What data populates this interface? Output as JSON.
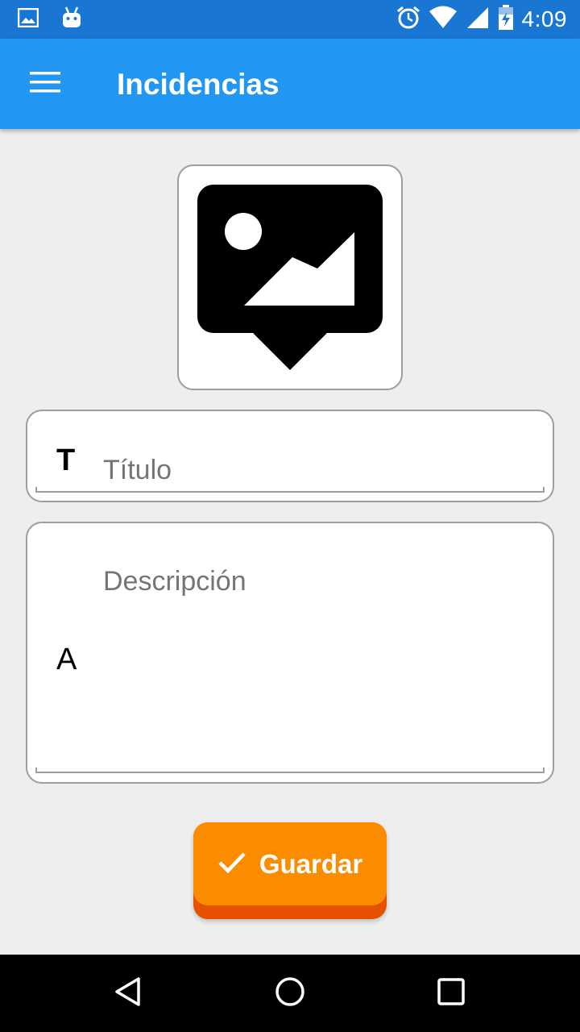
{
  "status_bar": {
    "time": "4:09",
    "left_icons": [
      "image-notification-icon",
      "android-notification-icon"
    ],
    "right_icons": [
      "alarm-icon",
      "wifi-icon",
      "signal-icon",
      "battery-charging-icon"
    ]
  },
  "app_bar": {
    "title": "Incidencias",
    "menu_icon": "hamburger-menu-icon",
    "color": "#2196f3"
  },
  "image_picker": {
    "icon": "add-photo-location-icon"
  },
  "form": {
    "title_field": {
      "prefix": "T",
      "placeholder": "Título",
      "value": ""
    },
    "description_field": {
      "prefix": "A",
      "placeholder": "Descripción",
      "value": ""
    }
  },
  "save_button": {
    "label": "Guardar",
    "icon": "check-icon",
    "color": "#fb8c00"
  },
  "nav_bar": {
    "buttons": [
      "back-icon",
      "home-icon",
      "recents-icon"
    ]
  }
}
